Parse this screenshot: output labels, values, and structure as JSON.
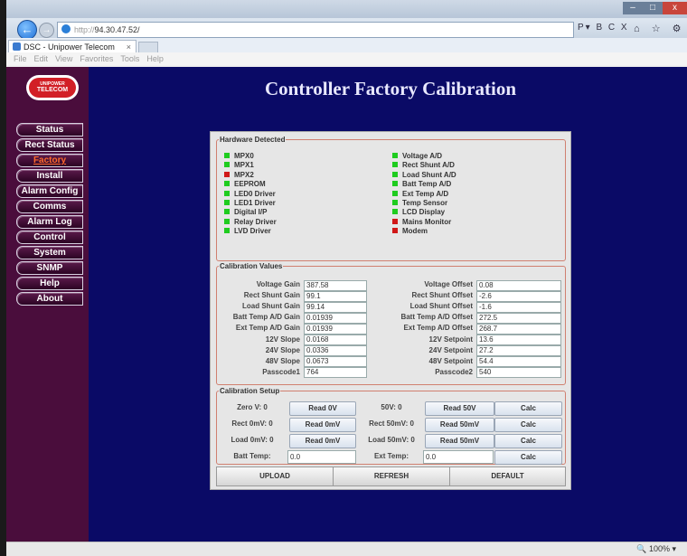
{
  "browser": {
    "url_proto": "http://",
    "url_host": "94.30.47.52/",
    "url_tools": "P▾ B C X",
    "tab_title": "DSC - Unipower Telecom",
    "tab_close": "×",
    "menu": [
      "File",
      "Edit",
      "View",
      "Favorites",
      "Tools",
      "Help"
    ],
    "zoom": "100%",
    "back_glyph": "←",
    "forward_glyph": "→",
    "window_controls": {
      "minimize": "–",
      "maximize": "□",
      "close": "x"
    },
    "toolbar_icons": "⌂ ☆ ⚙"
  },
  "logo": {
    "line1": "UNIPOWER",
    "line2": "TELECOM"
  },
  "nav": [
    "Status",
    "Rect Status",
    "Factory",
    "Install",
    "Alarm Config",
    "Comms",
    "Alarm Log",
    "Control",
    "System",
    "SNMP",
    "Help",
    "About"
  ],
  "nav_active": "Factory",
  "title": "Controller Factory Calibration",
  "hardware": {
    "legend": "Hardware Detected",
    "left": [
      {
        "label": "MPX0",
        "status": "ok"
      },
      {
        "label": "MPX1",
        "status": "ok"
      },
      {
        "label": "MPX2",
        "status": "fail"
      },
      {
        "label": "EEPROM",
        "status": "ok"
      },
      {
        "label": "LED0 Driver",
        "status": "ok"
      },
      {
        "label": "LED1 Driver",
        "status": "ok"
      },
      {
        "label": "Digital I/P",
        "status": "ok"
      },
      {
        "label": "Relay Driver",
        "status": "ok"
      },
      {
        "label": "LVD Driver",
        "status": "ok"
      }
    ],
    "right": [
      {
        "label": "Voltage A/D",
        "status": "ok"
      },
      {
        "label": "Rect Shunt A/D",
        "status": "ok"
      },
      {
        "label": "Load Shunt A/D",
        "status": "ok"
      },
      {
        "label": "Batt Temp A/D",
        "status": "ok"
      },
      {
        "label": "Ext Temp A/D",
        "status": "ok"
      },
      {
        "label": "Temp Sensor",
        "status": "ok"
      },
      {
        "label": "LCD Display",
        "status": "ok"
      },
      {
        "label": "Mains Monitor",
        "status": "fail"
      },
      {
        "label": "Modem",
        "status": "fail"
      }
    ],
    "colors": {
      "ok": "#1fcc1f",
      "fail": "#d01818"
    }
  },
  "calibration": {
    "legend": "Calibration Values",
    "rows": [
      {
        "l_label": "Voltage Gain",
        "l_value": "387.58",
        "r_label": "Voltage Offset",
        "r_value": "0.08"
      },
      {
        "l_label": "Rect Shunt Gain",
        "l_value": "99.1",
        "r_label": "Rect Shunt Offset",
        "r_value": "-2.6"
      },
      {
        "l_label": "Load Shunt Gain",
        "l_value": "99.14",
        "r_label": "Load Shunt Offset",
        "r_value": "-1.6"
      },
      {
        "l_label": "Batt Temp A/D Gain",
        "l_value": "0.01939",
        "r_label": "Batt Temp A/D Offset",
        "r_value": "272.5"
      },
      {
        "l_label": "Ext Temp A/D Gain",
        "l_value": "0.01939",
        "r_label": "Ext Temp A/D Offset",
        "r_value": "268.7"
      },
      {
        "l_label": "12V Slope",
        "l_value": "0.0168",
        "r_label": "12V Setpoint",
        "r_value": "13.6"
      },
      {
        "l_label": "24V Slope",
        "l_value": "0.0336",
        "r_label": "24V Setpoint",
        "r_value": "27.2"
      },
      {
        "l_label": "48V Slope",
        "l_value": "0.0673",
        "r_label": "48V Setpoint",
        "r_value": "54.4"
      },
      {
        "l_label": "Passcode1",
        "l_value": "764",
        "r_label": "Passcode2",
        "r_value": "540"
      }
    ]
  },
  "setup": {
    "legend": "Calibration Setup",
    "rows": [
      {
        "l_label": "Zero V: 0",
        "l_button": "Read 0V",
        "r_label": "50V: 0",
        "r_button": "Read 50V",
        "calc": "Calc"
      },
      {
        "l_label": "Rect 0mV: 0",
        "l_button": "Read 0mV",
        "r_label": "Rect 50mV: 0",
        "r_button": "Read 50mV",
        "calc": "Calc"
      },
      {
        "l_label": "Load 0mV: 0",
        "l_button": "Read 0mV",
        "r_label": "Load 50mV: 0",
        "r_button": "Read 50mV",
        "calc": "Calc"
      }
    ],
    "temp_row": {
      "l_label": "Batt Temp:",
      "l_value": "0.0",
      "r_label": "Ext Temp:",
      "r_value": "0.0",
      "calc": "Calc"
    }
  },
  "actions": {
    "upload": "UPLOAD",
    "refresh": "REFRESH",
    "default": "DEFAULT"
  }
}
